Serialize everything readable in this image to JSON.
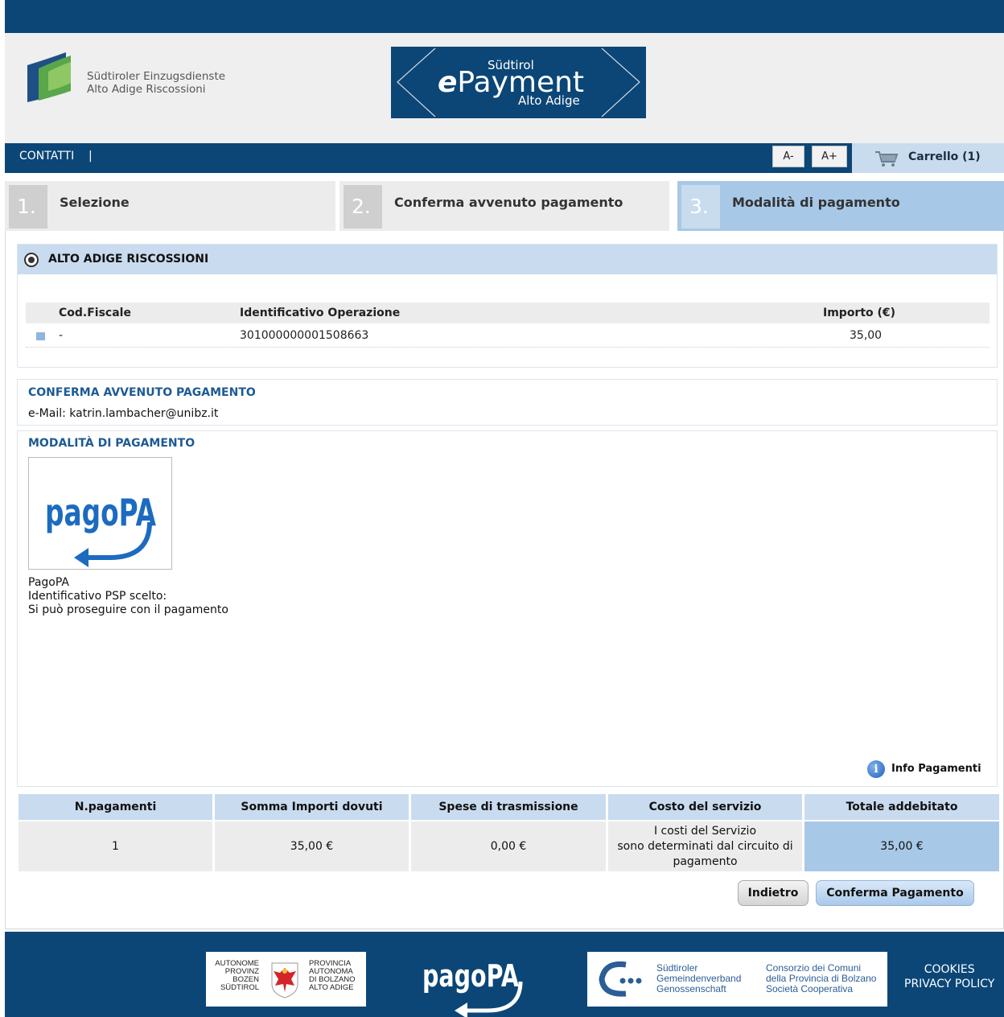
{
  "header": {
    "org_line1": "Südtiroler Einzugsdienste",
    "org_line2": "Alto Adige Riscossioni",
    "epay_top": "Südtirol",
    "epay_e": "e",
    "epay_main": "Payment",
    "epay_bottom": "Alto Adige"
  },
  "nav": {
    "contatti": "CONTATTI",
    "separator": "|",
    "font_minus": "A-",
    "font_plus": "A+",
    "cart": "Carrello (1)"
  },
  "steps": [
    {
      "num": "1.",
      "label": "Selezione"
    },
    {
      "num": "2.",
      "label": "Conferma avvenuto pagamento"
    },
    {
      "num": "3.",
      "label": "Modalità di pagamento"
    }
  ],
  "org": {
    "title": "ALTO ADIGE RISCOSSIONI",
    "columns": [
      "Cod.Fiscale",
      "Identificativo Operazione",
      "Importo (€)"
    ],
    "row": {
      "cod_fiscale": "-",
      "identificativo": "301000000001508663",
      "importo": "35,00"
    }
  },
  "conferma": {
    "title": "CONFERMA AVVENUTO PAGAMENTO",
    "email": "e-Mail: katrin.lambacher@unibz.it"
  },
  "modalita": {
    "title": "MODALITÀ DI PAGAMENTO",
    "logo_text": "pagoPA",
    "method": "PagoPA",
    "psp": "Identificativo PSP scelto:",
    "note": "Si può proseguire con il pagamento",
    "info": "Info Pagamenti"
  },
  "summary": {
    "headers": [
      "N.pagamenti",
      "Somma Importi dovuti",
      "Spese di trasmissione",
      "Costo del servizio",
      "Totale addebitato"
    ],
    "n_pagamenti": "1",
    "somma": "35,00 €",
    "spese": "0,00 €",
    "costo_line1": "I costi del Servizio",
    "costo_line2": "sono determinati dal circuito di",
    "costo_line3": "pagamento",
    "totale": "35,00 €"
  },
  "buttons": {
    "back": "Indietro",
    "confirm": "Conferma Pagamento"
  },
  "footer": {
    "prov_de": [
      "AUTONOME",
      "PROVINZ",
      "BOZEN",
      "SÜDTIROL"
    ],
    "prov_it": [
      "PROVINCIA",
      "AUTONOMA",
      "DI BOLZANO",
      "ALTO ADIGE"
    ],
    "pago_logo": "pagoPA",
    "gem_de": [
      "Südtiroler",
      "Gemeindenverband",
      "Genossenschaft"
    ],
    "gem_it": [
      "Consorzio dei Comuni",
      "della Provincia di Bolzano",
      "Società Cooperativa"
    ],
    "cookies": "COOKIES",
    "privacy": "PRIVACY POLICY"
  },
  "colors": {
    "brand_blue": "#0b4677",
    "light_blue": "#c9dbef",
    "active_step": "#a8c8e7",
    "section_title": "#1d5a95"
  }
}
